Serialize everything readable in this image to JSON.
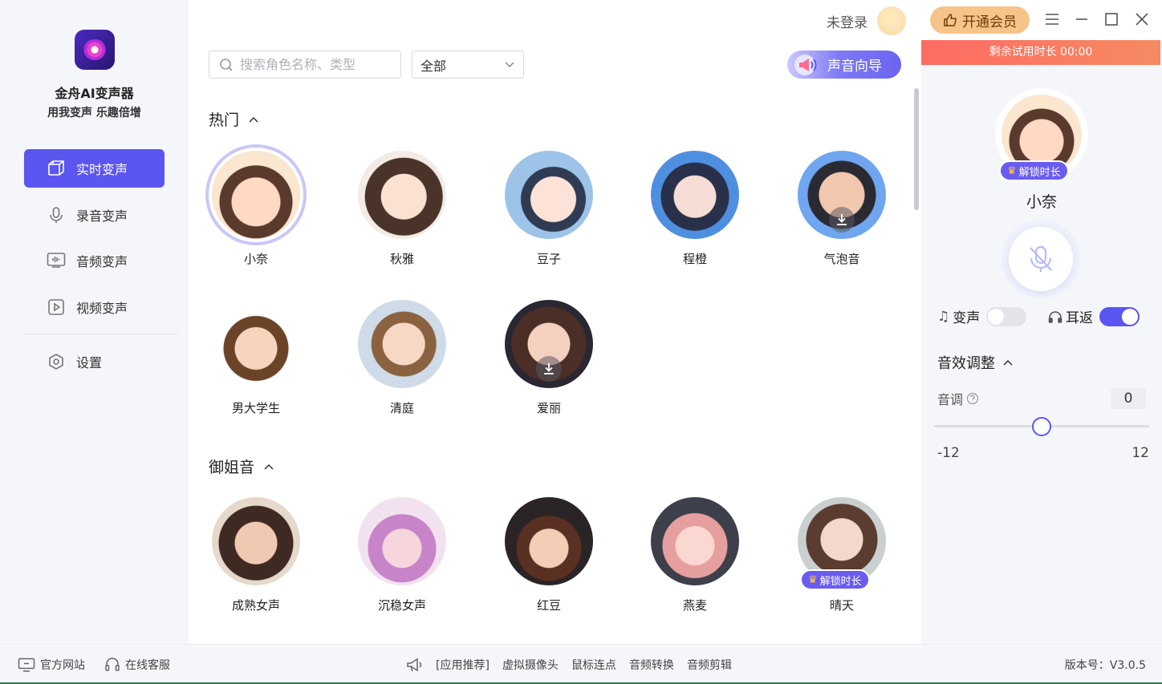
{
  "app": {
    "name": "金舟AI变声器",
    "slogan": "用我变声 乐趣倍增"
  },
  "sidebar": {
    "items": [
      {
        "label": "实时变声",
        "icon": "cube-icon",
        "active": true
      },
      {
        "label": "录音变声",
        "icon": "microphone-icon",
        "active": false
      },
      {
        "label": "音频变声",
        "icon": "audio-wave-icon",
        "active": false
      },
      {
        "label": "视频变声",
        "icon": "video-play-icon",
        "active": false
      }
    ],
    "settings": {
      "label": "设置",
      "icon": "gear-icon"
    }
  },
  "toolbar": {
    "search_placeholder": "搜索角色名称、类型",
    "filter_value": "全部",
    "guide_label": "声音向导"
  },
  "titlebar": {
    "login_text": "未登录",
    "vip_label": "开通会员"
  },
  "sections": [
    {
      "title": "热门",
      "characters": [
        {
          "name": "小奈",
          "selected": true
        },
        {
          "name": "秋雅"
        },
        {
          "name": "豆子"
        },
        {
          "name": "程橙"
        },
        {
          "name": "气泡音",
          "download": true
        },
        {
          "name": "男大学生"
        },
        {
          "name": "清庭"
        },
        {
          "name": "爱丽",
          "download": true
        }
      ]
    },
    {
      "title": "御姐音",
      "characters": [
        {
          "name": "成熟女声"
        },
        {
          "name": "沉稳女声"
        },
        {
          "name": "红豆"
        },
        {
          "name": "燕麦"
        },
        {
          "name": "晴天",
          "unlock": "解锁时长"
        }
      ]
    }
  ],
  "panel": {
    "trial_text": "剩余试用时长 00:00",
    "current_name": "小奈",
    "unlock_badge": "解锁时长",
    "voice_change_label": "变声",
    "voice_change_on": false,
    "monitor_label": "耳返",
    "monitor_on": true,
    "effects_title": "音效调整",
    "pitch_label": "音调",
    "pitch_value": "0",
    "pitch_min": "-12",
    "pitch_max": "12"
  },
  "footer": {
    "website": "官方网站",
    "support": "在线客服",
    "recommend": "[应用推荐]",
    "links": [
      "虚拟摄像头",
      "鼠标连点",
      "音频转换",
      "音频剪辑"
    ],
    "version": "版本号：V3.0.5"
  },
  "colors": {
    "accent": "#5b56f0",
    "vip": "#f6c489",
    "trial": "#ff6b63",
    "sidebar_bg": "#f5f6fa"
  }
}
